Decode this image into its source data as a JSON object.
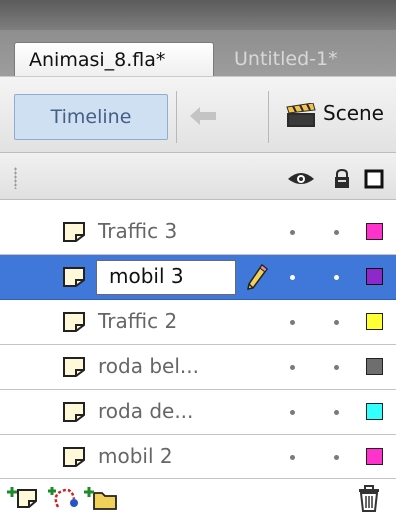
{
  "tabs": [
    {
      "label": "Animasi_8.fla*",
      "active": true
    },
    {
      "label": "Untitled-1*",
      "active": false
    }
  ],
  "toolbar": {
    "timeline_label": "Timeline",
    "scene_label": "Scene"
  },
  "layer_header": {
    "icons": [
      "eye-icon",
      "lock-icon",
      "outline-icon"
    ]
  },
  "layers": [
    {
      "name": "Traffic 3",
      "color": "#ff33cc",
      "selected": false
    },
    {
      "name": "mobil 3",
      "color": "#8f28c8",
      "selected": true,
      "editing": true
    },
    {
      "name": "Traffic 2",
      "color": "#ffff33",
      "selected": false
    },
    {
      "name": "roda bel...",
      "color": "#6e6e6e",
      "selected": false
    },
    {
      "name": "roda de...",
      "color": "#33ffff",
      "selected": false
    },
    {
      "name": "mobil 2",
      "color": "#ff33cc",
      "selected": false
    }
  ],
  "bottom_toolbar": {
    "icons": [
      "new-layer-icon",
      "motion-guide-icon",
      "new-folder-icon",
      "trash-icon"
    ]
  },
  "colors": {
    "selection": "#3f78d8",
    "timeline_button_bg": "#cfe0f2"
  }
}
